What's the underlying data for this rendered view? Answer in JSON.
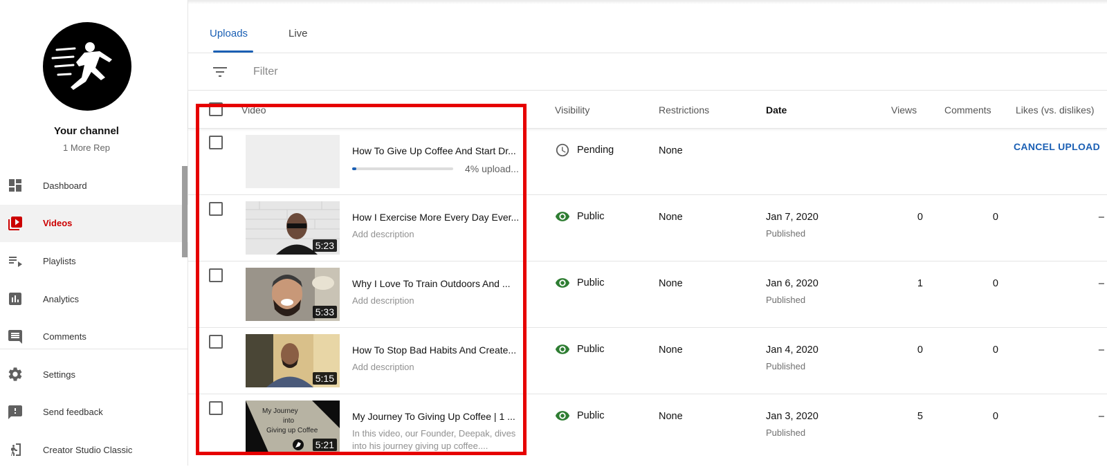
{
  "colors": {
    "accent": "#1a5fb4",
    "brand_red": "#cc0000",
    "public_green": "#2e7d32",
    "highlight": "#e60000"
  },
  "sidebar": {
    "channel_title": "Your channel",
    "channel_name": "1 More Rep",
    "items": [
      {
        "label": "Dashboard",
        "icon": "dashboard-icon"
      },
      {
        "label": "Videos",
        "icon": "videos-icon",
        "active": true
      },
      {
        "label": "Playlists",
        "icon": "playlists-icon"
      },
      {
        "label": "Analytics",
        "icon": "analytics-icon"
      },
      {
        "label": "Comments",
        "icon": "comments-icon"
      },
      {
        "label": "Settings",
        "icon": "gear-icon"
      },
      {
        "label": "Send feedback",
        "icon": "feedback-icon"
      },
      {
        "label": "Creator Studio Classic",
        "icon": "exit-icon"
      }
    ]
  },
  "tabs": [
    {
      "label": "Uploads",
      "active": true
    },
    {
      "label": "Live"
    }
  ],
  "filter": {
    "placeholder": "Filter",
    "icon": "filter-icon"
  },
  "table": {
    "headers": {
      "video": "Video",
      "visibility": "Visibility",
      "restrictions": "Restrictions",
      "date": "Date",
      "views": "Views",
      "comments": "Comments",
      "likes": "Likes (vs. dislikes)"
    },
    "rows": [
      {
        "title": "How To Give Up Coffee And Start Dr...",
        "upload_progress": 0.04,
        "progress_text": "4% upload...",
        "visibility": "Pending",
        "visibility_icon": "clock-icon",
        "restrictions": "None",
        "action": "CANCEL UPLOAD"
      },
      {
        "title": "How I Exercise More Every Day Ever...",
        "description": "Add description",
        "duration": "5:23",
        "visibility": "Public",
        "visibility_icon": "eye-icon",
        "restrictions": "None",
        "date": "Jan 7, 2020",
        "date_status": "Published",
        "views": "0",
        "comments": "0",
        "likes": "–"
      },
      {
        "title": "Why I Love To Train Outdoors And ...",
        "description": "Add description",
        "duration": "5:33",
        "visibility": "Public",
        "visibility_icon": "eye-icon",
        "restrictions": "None",
        "date": "Jan 6, 2020",
        "date_status": "Published",
        "views": "1",
        "comments": "0",
        "likes": "–"
      },
      {
        "title": "How To Stop Bad Habits And Create...",
        "description": "Add description",
        "duration": "5:15",
        "visibility": "Public",
        "visibility_icon": "eye-icon",
        "restrictions": "None",
        "date": "Jan 4, 2020",
        "date_status": "Published",
        "views": "0",
        "comments": "0",
        "likes": "–"
      },
      {
        "title": "My Journey To Giving Up Coffee | 1 ...",
        "description": "In this video, our Founder, Deepak, dives into his journey giving up coffee....",
        "duration": "5:21",
        "thumb_text": [
          "My Journey",
          "into",
          "Giving up Coffee"
        ],
        "visibility": "Public",
        "visibility_icon": "eye-icon",
        "restrictions": "None",
        "date": "Jan 3, 2020",
        "date_status": "Published",
        "views": "5",
        "comments": "0",
        "likes": "–"
      }
    ]
  }
}
